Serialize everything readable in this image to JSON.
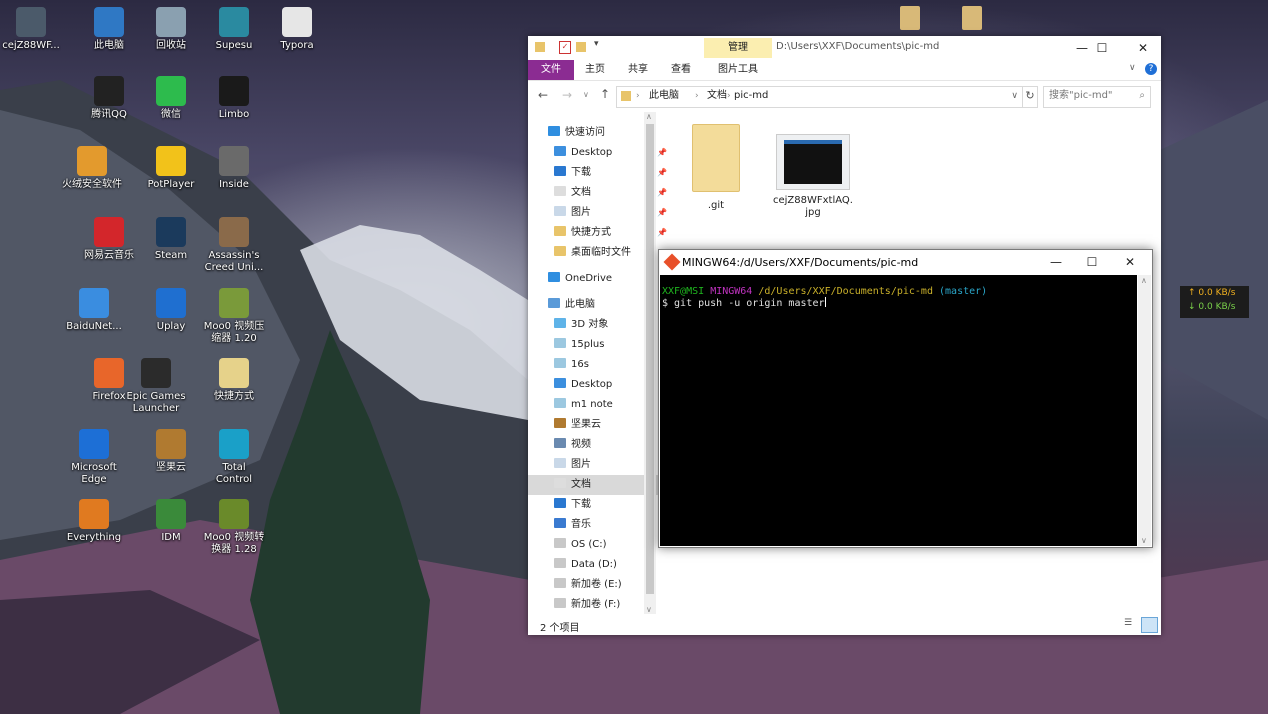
{
  "desktop": {
    "icons": [
      {
        "label": "cejZ88WF...",
        "icon": "image-thumbnail-icon",
        "color": "#4b5a6a"
      },
      {
        "label": "此电脑",
        "icon": "computer-icon",
        "color": "#2f78c4"
      },
      {
        "label": "回收站",
        "icon": "recycle-bin-icon",
        "color": "#8aa0b0"
      },
      {
        "label": "Supesu",
        "icon": "supesu-app-icon",
        "color": "#2a8aa0"
      },
      {
        "label": "Typora",
        "icon": "typora-app-icon",
        "color": "#e6e6e6"
      },
      {
        "label": "腾讯QQ",
        "icon": "qq-penguin-icon",
        "color": "#222222"
      },
      {
        "label": "微信",
        "icon": "wechat-icon",
        "color": "#2dbb4d"
      },
      {
        "label": "Limbo",
        "icon": "limbo-game-icon",
        "color": "#1a1a1a"
      },
      {
        "label": "火绒安全软件",
        "icon": "huorong-shield-icon",
        "color": "#e39a2d"
      },
      {
        "label": "PotPlayer",
        "icon": "potplayer-icon",
        "color": "#f2c21a"
      },
      {
        "label": "Inside",
        "icon": "inside-game-icon",
        "color": "#6a6a6a"
      },
      {
        "label": "网易云音乐",
        "icon": "netease-music-icon",
        "color": "#d3262b"
      },
      {
        "label": "Steam",
        "icon": "steam-icon",
        "color": "#1b3a5c"
      },
      {
        "label": "Assassin's Creed Uni...",
        "icon": "assassins-creed-icon",
        "color": "#8a6a4a"
      },
      {
        "label": "BaiduNet...",
        "icon": "baidu-netdisk-icon",
        "color": "#3a8de0"
      },
      {
        "label": "Uplay",
        "icon": "uplay-icon",
        "color": "#1f6fd0"
      },
      {
        "label": "Moo0 视频压缩器 1.20",
        "icon": "moo0-video-compressor-icon",
        "color": "#7a9a3a"
      },
      {
        "label": "Firefox",
        "icon": "firefox-icon",
        "color": "#e8662a"
      },
      {
        "label": "Epic Games Launcher",
        "icon": "epic-games-icon",
        "color": "#2b2b2b"
      },
      {
        "label": "快捷方式",
        "icon": "shortcut-icon",
        "color": "#e6d28a"
      },
      {
        "label": "Microsoft Edge",
        "icon": "edge-icon",
        "color": "#1d6fd6"
      },
      {
        "label": "坚果云",
        "icon": "nutstore-icon",
        "color": "#b07a30"
      },
      {
        "label": "Total Control",
        "icon": "total-control-icon",
        "color": "#1aa0c8"
      },
      {
        "label": "Everything",
        "icon": "everything-search-icon",
        "color": "#e07a20"
      },
      {
        "label": "IDM",
        "icon": "idm-icon",
        "color": "#3a8a3a"
      },
      {
        "label": "Moo0 视频转换器 1.28",
        "icon": "moo0-video-converter-icon",
        "color": "#6a8a2a"
      }
    ],
    "top_folder_icons": [
      "folder-icon",
      "folder-icon"
    ]
  },
  "explorer": {
    "path": "D:\\Users\\XXF\\Documents\\pic-md",
    "manage_tab": "管理",
    "ribbon_tabs": [
      "文件",
      "主页",
      "共享",
      "查看",
      "图片工具"
    ],
    "breadcrumb": [
      "此电脑",
      "文档",
      "pic-md"
    ],
    "search_placeholder": "搜索\"pic-md\"",
    "nav": {
      "quick_access": "快速访问",
      "quick_items": [
        "Desktop",
        "下载",
        "文档",
        "图片",
        "快捷方式",
        "桌面临时文件"
      ],
      "onedrive": "OneDrive",
      "this_pc": "此电脑",
      "pc_items": [
        "3D 对象",
        "15plus",
        "16s",
        "Desktop",
        "m1 note",
        "坚果云",
        "视频",
        "图片",
        "文档",
        "下载",
        "音乐",
        "OS (C:)",
        "Data (D:)",
        "新加卷 (E:)",
        "新加卷 (F:)"
      ]
    },
    "files": [
      {
        "name": ".git",
        "icon": "folder-icon"
      },
      {
        "name": "cejZ88WFxtlAQ.jpg",
        "icon": "image-file-icon"
      }
    ],
    "status": "2 个项目"
  },
  "terminal": {
    "title": "MINGW64:/d/Users/XXF/Documents/pic-md",
    "prompt_user": "XXF@MSI",
    "prompt_env": "MINGW64",
    "prompt_path": "/d/Users/XXF/Documents/pic-md",
    "prompt_branch": "(master)",
    "command": "$ git push -u origin master",
    "colors": {
      "user": "#1fb51f",
      "env": "#c033c0",
      "path": "#c9b02a",
      "branch": "#2aa6c9"
    }
  },
  "netspeed": {
    "up": "0.0 KB/s",
    "down": "0.0 KB/s",
    "up_arrow": "↑",
    "down_arrow": "↓"
  }
}
